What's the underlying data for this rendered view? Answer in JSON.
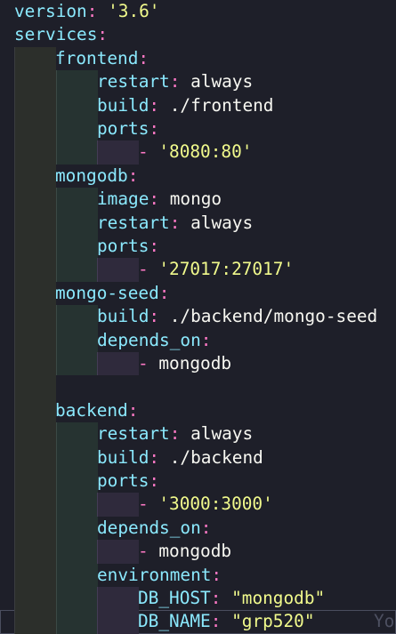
{
  "lines": [
    {
      "indent": 0,
      "segments": [
        {
          "t": "k",
          "v": "version"
        },
        {
          "t": "p",
          "v": ": "
        },
        {
          "t": "s",
          "v": "'3.6'"
        }
      ]
    },
    {
      "indent": 0,
      "segments": [
        {
          "t": "k",
          "v": "services"
        },
        {
          "t": "p",
          "v": ":"
        }
      ]
    },
    {
      "indent": 1,
      "segments": [
        {
          "t": "k",
          "v": "frontend"
        },
        {
          "t": "p",
          "v": ":"
        }
      ]
    },
    {
      "indent": 2,
      "segments": [
        {
          "t": "k",
          "v": "restart"
        },
        {
          "t": "p",
          "v": ": "
        },
        {
          "t": "v",
          "v": "always"
        }
      ]
    },
    {
      "indent": 2,
      "segments": [
        {
          "t": "k",
          "v": "build"
        },
        {
          "t": "p",
          "v": ": "
        },
        {
          "t": "v",
          "v": "./frontend"
        }
      ]
    },
    {
      "indent": 2,
      "segments": [
        {
          "t": "k",
          "v": "ports"
        },
        {
          "t": "p",
          "v": ":"
        }
      ]
    },
    {
      "indent": 3,
      "segments": [
        {
          "t": "p",
          "v": "- "
        },
        {
          "t": "s",
          "v": "'8080:80'"
        }
      ]
    },
    {
      "indent": 1,
      "segments": [
        {
          "t": "k",
          "v": "mongodb"
        },
        {
          "t": "p",
          "v": ":"
        }
      ]
    },
    {
      "indent": 2,
      "segments": [
        {
          "t": "k",
          "v": "image"
        },
        {
          "t": "p",
          "v": ": "
        },
        {
          "t": "v",
          "v": "mongo"
        }
      ]
    },
    {
      "indent": 2,
      "segments": [
        {
          "t": "k",
          "v": "restart"
        },
        {
          "t": "p",
          "v": ": "
        },
        {
          "t": "v",
          "v": "always"
        }
      ]
    },
    {
      "indent": 2,
      "segments": [
        {
          "t": "k",
          "v": "ports"
        },
        {
          "t": "p",
          "v": ":"
        }
      ]
    },
    {
      "indent": 3,
      "segments": [
        {
          "t": "p",
          "v": "- "
        },
        {
          "t": "s",
          "v": "'27017:27017'"
        }
      ]
    },
    {
      "indent": 1,
      "segments": [
        {
          "t": "k",
          "v": "mongo-seed"
        },
        {
          "t": "p",
          "v": ":"
        }
      ]
    },
    {
      "indent": 2,
      "segments": [
        {
          "t": "k",
          "v": "build"
        },
        {
          "t": "p",
          "v": ": "
        },
        {
          "t": "v",
          "v": "./backend/mongo-seed"
        }
      ]
    },
    {
      "indent": 2,
      "segments": [
        {
          "t": "k",
          "v": "depends_on"
        },
        {
          "t": "p",
          "v": ":"
        }
      ]
    },
    {
      "indent": 3,
      "segments": [
        {
          "t": "p",
          "v": "- "
        },
        {
          "t": "v",
          "v": "mongodb"
        }
      ]
    },
    {
      "indent": 1,
      "segments": []
    },
    {
      "indent": 1,
      "segments": [
        {
          "t": "k",
          "v": "backend"
        },
        {
          "t": "p",
          "v": ":"
        }
      ]
    },
    {
      "indent": 2,
      "segments": [
        {
          "t": "k",
          "v": "restart"
        },
        {
          "t": "p",
          "v": ": "
        },
        {
          "t": "v",
          "v": "always"
        }
      ]
    },
    {
      "indent": 2,
      "segments": [
        {
          "t": "k",
          "v": "build"
        },
        {
          "t": "p",
          "v": ": "
        },
        {
          "t": "v",
          "v": "./backend"
        }
      ]
    },
    {
      "indent": 2,
      "segments": [
        {
          "t": "k",
          "v": "ports"
        },
        {
          "t": "p",
          "v": ":"
        }
      ]
    },
    {
      "indent": 3,
      "segments": [
        {
          "t": "p",
          "v": "- "
        },
        {
          "t": "s",
          "v": "'3000:3000'"
        }
      ]
    },
    {
      "indent": 2,
      "segments": [
        {
          "t": "k",
          "v": "depends_on"
        },
        {
          "t": "p",
          "v": ":"
        }
      ]
    },
    {
      "indent": 3,
      "segments": [
        {
          "t": "p",
          "v": "- "
        },
        {
          "t": "v",
          "v": "mongodb"
        }
      ]
    },
    {
      "indent": 2,
      "segments": [
        {
          "t": "k",
          "v": "environment"
        },
        {
          "t": "p",
          "v": ":"
        }
      ]
    },
    {
      "indent": 3,
      "segments": [
        {
          "t": "k",
          "v": "DB_HOST"
        },
        {
          "t": "p",
          "v": ": "
        },
        {
          "t": "s",
          "v": "\"mongodb\""
        }
      ]
    },
    {
      "indent": 3,
      "current": true,
      "segments": [
        {
          "t": "k",
          "v": "DB_NAME"
        },
        {
          "t": "p",
          "v": ": "
        },
        {
          "t": "s",
          "v": "\"grp520\""
        }
      ],
      "hint": "Yo"
    }
  ],
  "colors": {
    "background": "#1e1f29",
    "key": "#8be9fd",
    "punctuation": "#ff79c6",
    "value": "#f8f8f2",
    "string": "#f1fa8c"
  }
}
